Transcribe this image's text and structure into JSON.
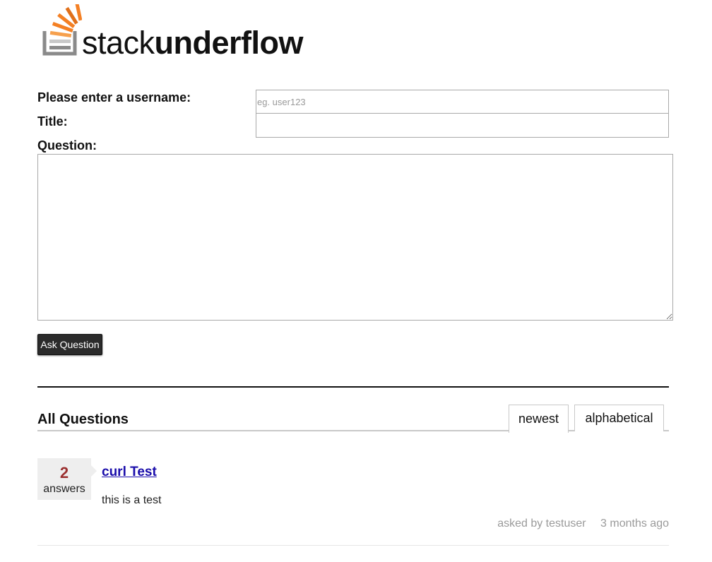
{
  "brand": {
    "name_light": "stack",
    "name_bold": "underflow",
    "colors": {
      "stack_gray": "#8a8a8a",
      "flame_orange": "#f48024",
      "flame_dark": "#e0701a"
    },
    "icon": "stack-logo-icon"
  },
  "form": {
    "username_label": "Please enter a username:",
    "username_placeholder": "eg. user123",
    "username_value": "",
    "title_label": "Title:",
    "title_value": "",
    "question_label": "Question:",
    "question_value": "",
    "submit_label": "Ask Question"
  },
  "questions_section": {
    "heading": "All Questions",
    "tabs": [
      {
        "label": "newest",
        "active": true
      },
      {
        "label": "alphabetical",
        "active": false
      }
    ],
    "items": [
      {
        "answer_count": "2",
        "answer_label": "answers",
        "title": "curl Test",
        "body": "this is a test",
        "asked_by": "asked by testuser",
        "time": "3 months ago"
      }
    ]
  }
}
